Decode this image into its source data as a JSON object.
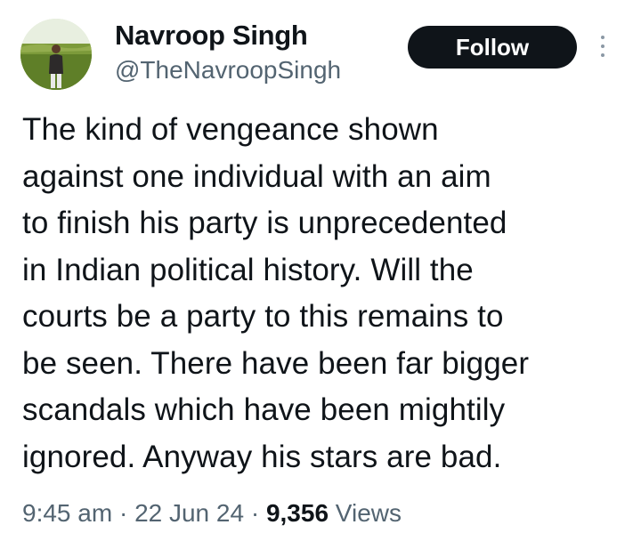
{
  "author": {
    "display_name": "Navroop Singh",
    "handle": "@TheNavroopSingh",
    "avatar_icon": "profile-photo-icon"
  },
  "actions": {
    "follow_label": "Follow",
    "more_icon": "more-vertical-icon"
  },
  "tweet": {
    "text": "The kind of vengeance shown\nagainst one individual with an aim\nto finish his party is unprecedented\nin Indian political history. Will the\ncourts be a party to this remains to\nbe seen. There have been far bigger\nscandals which have been mightily\nignored. Anyway his stars are bad."
  },
  "meta": {
    "time": "9:45 am",
    "separator": " · ",
    "date": "22 Jun 24",
    "views_count": "9,356",
    "views_label": " Views"
  },
  "colors": {
    "text_primary": "#0f1419",
    "text_secondary": "#536471",
    "button_bg": "#0f1419",
    "button_text": "#ffffff"
  }
}
